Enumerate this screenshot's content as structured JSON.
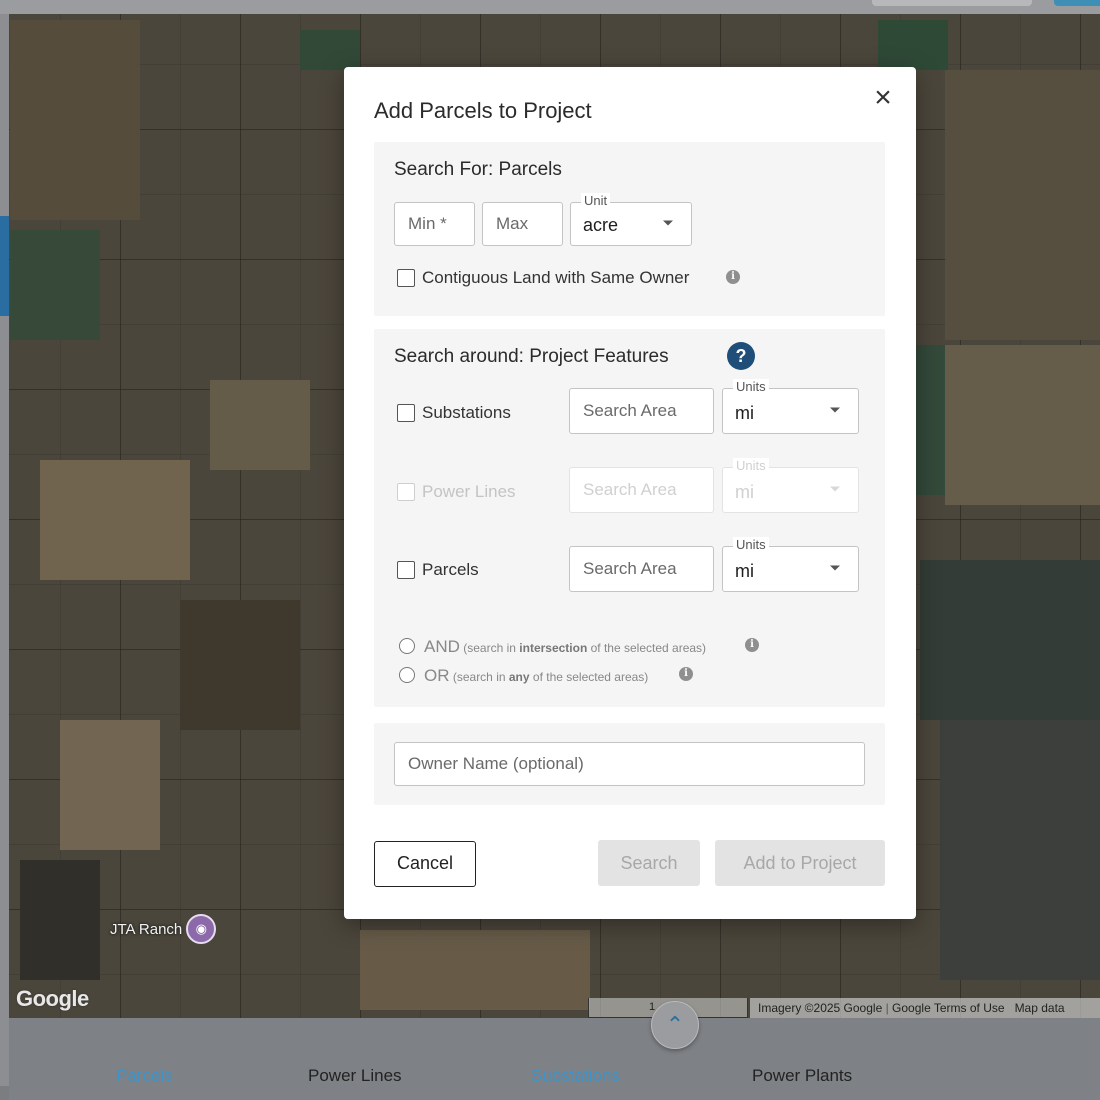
{
  "modal": {
    "title": "Add Parcels to Project",
    "close_symbol": "×",
    "size_section": {
      "title": "Search For: Parcels",
      "min_placeholder": "Min *",
      "max_placeholder": "Max",
      "unit_legend": "Unit",
      "unit_value": "acre",
      "contiguous_label": "Contiguous Land with Same Owner",
      "contiguous_checked": false
    },
    "features_section": {
      "title": "Search around: Project Features",
      "help_symbol": "?",
      "rows": [
        {
          "label": "Substations",
          "placeholder": "Search Area",
          "units_legend": "Units",
          "units_value": "mi",
          "enabled": true
        },
        {
          "label": "Power Lines",
          "placeholder": "Search Area",
          "units_legend": "Units",
          "units_value": "mi",
          "enabled": false
        },
        {
          "label": "Parcels",
          "placeholder": "Search Area",
          "units_legend": "Units",
          "units_value": "mi",
          "enabled": true
        }
      ],
      "and_option": {
        "word": "AND",
        "pre": "(search in ",
        "bold": "intersection",
        "post": " of the selected areas)"
      },
      "or_option": {
        "word": "OR",
        "pre": "(search in ",
        "bold": "any",
        "post": " of the selected areas)"
      }
    },
    "owner_section": {
      "placeholder": "Owner Name (optional)"
    },
    "buttons": {
      "cancel": "Cancel",
      "search": "Search",
      "add": "Add to Project"
    }
  },
  "map": {
    "logo_text": "Google",
    "scale_text": "1",
    "attribution": "Imagery ©2025 Google",
    "terms": "Google Terms of Use",
    "map_data": "Map data",
    "marker_label": "JTA Ranch"
  },
  "bottom_tabs": [
    {
      "label": "Parcels",
      "active": true
    },
    {
      "label": "Power Lines",
      "active": false
    },
    {
      "label": "Substations",
      "active": true
    },
    {
      "label": "Power Plants",
      "active": false
    }
  ],
  "colors": {
    "active_tab": "#3e93c8",
    "inactive_tab": "#222222",
    "help_icon": "#1f4e79"
  }
}
